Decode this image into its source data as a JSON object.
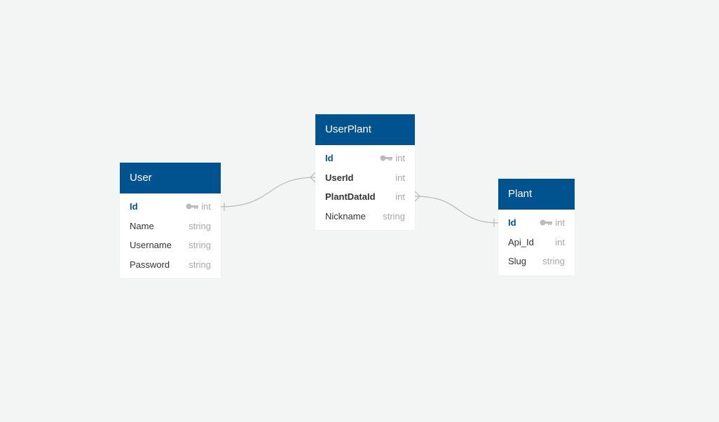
{
  "colors": {
    "header": "#00538f",
    "background": "#f3f4f4",
    "connector": "#b8b8b8"
  },
  "tables": [
    {
      "name": "User",
      "fields": [
        {
          "name": "Id",
          "type": "int",
          "pk": true
        },
        {
          "name": "Name",
          "type": "string"
        },
        {
          "name": "Username",
          "type": "string"
        },
        {
          "name": "Password",
          "type": "string"
        }
      ]
    },
    {
      "name": "UserPlant",
      "fields": [
        {
          "name": "Id",
          "type": "int",
          "pk": true
        },
        {
          "name": "UserId",
          "type": "int",
          "fk": true
        },
        {
          "name": "PlantDataId",
          "type": "int",
          "fk": true
        },
        {
          "name": "Nickname",
          "type": "string"
        }
      ]
    },
    {
      "name": "Plant",
      "fields": [
        {
          "name": "Id",
          "type": "int",
          "pk": true
        },
        {
          "name": "Api_Id",
          "type": "int"
        },
        {
          "name": "Slug",
          "type": "string"
        }
      ]
    }
  ],
  "relations": [
    {
      "from": "User.Id",
      "to": "UserPlant.UserId",
      "type": "one-to-many"
    },
    {
      "from": "Plant.Id",
      "to": "UserPlant.PlantDataId",
      "type": "one-to-many"
    }
  ]
}
